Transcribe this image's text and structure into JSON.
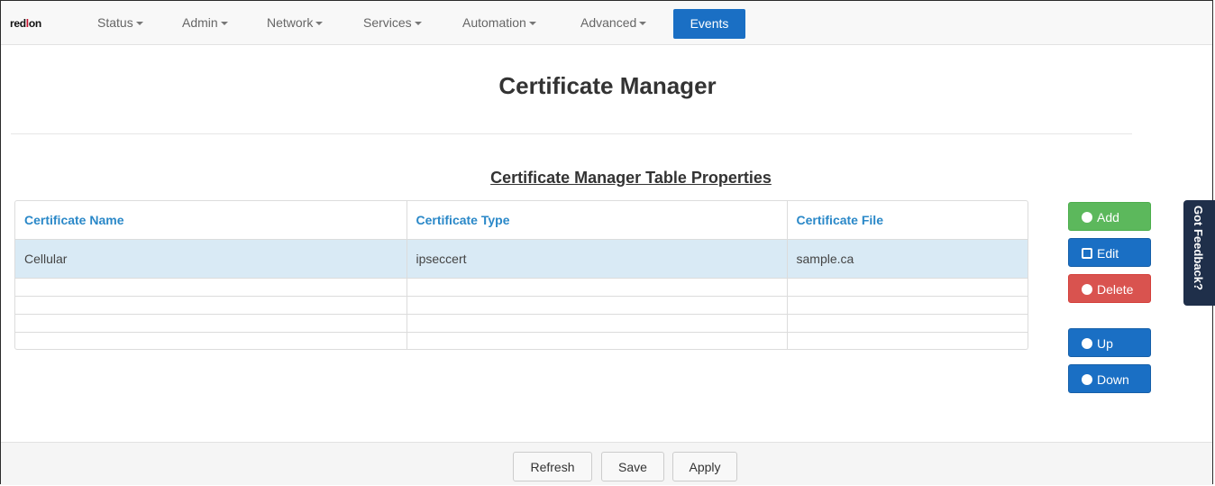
{
  "brand": {
    "text_black": "red",
    "text_red": "l",
    "text_black2": "on"
  },
  "nav": {
    "items": [
      "Status",
      "Admin",
      "Network",
      "Services",
      "Automation",
      "Advanced"
    ],
    "events_label": "Events"
  },
  "page": {
    "title": "Certificate Manager",
    "section_title": "Certificate Manager Table Properties"
  },
  "table": {
    "headers": [
      "Certificate Name",
      "Certificate Type",
      "Certificate File"
    ],
    "rows": [
      [
        "Cellular",
        "ipseccert",
        "sample.ca"
      ],
      [
        "",
        "",
        ""
      ],
      [
        "",
        "",
        ""
      ],
      [
        "",
        "",
        ""
      ],
      [
        "",
        "",
        ""
      ]
    ]
  },
  "actions": {
    "add": "Add",
    "edit": "Edit",
    "delete": "Delete",
    "up": "Up",
    "down": "Down"
  },
  "feedback": {
    "label": "Got Feedback?"
  },
  "footer": {
    "refresh": "Refresh",
    "save": "Save",
    "apply": "Apply"
  },
  "colors": {
    "accent": "#1a6fc4",
    "green": "#5cb85c",
    "red": "#d9534f",
    "header_text": "#2a88c8",
    "selected_row": "#d9eaf5"
  }
}
